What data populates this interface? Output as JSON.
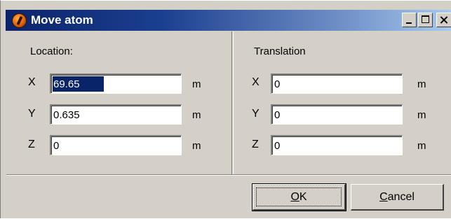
{
  "window": {
    "title": "Move atom",
    "app_icon": "app-logo-icon"
  },
  "location": {
    "title": "Location:",
    "rows": [
      {
        "axis": "X",
        "value": "69.65",
        "unit": "m"
      },
      {
        "axis": "Y",
        "value": "0.635",
        "unit": "m"
      },
      {
        "axis": "Z",
        "value": "0",
        "unit": "m"
      }
    ]
  },
  "translation": {
    "title": "Translation",
    "rows": [
      {
        "axis": "X",
        "value": "0",
        "unit": "m"
      },
      {
        "axis": "Y",
        "value": "0",
        "unit": "m"
      },
      {
        "axis": "Z",
        "value": "0",
        "unit": "m"
      }
    ]
  },
  "buttons": {
    "ok_mnemonic": "O",
    "ok_rest": "K",
    "cancel_mnemonic": "C",
    "cancel_rest": "ancel"
  },
  "colors": {
    "title_gradient_start": "#0a246a",
    "title_gradient_end": "#a6caf0",
    "dialog_face": "#d4d0c8",
    "selection": "#0a246a"
  }
}
